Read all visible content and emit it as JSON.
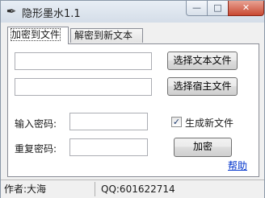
{
  "window": {
    "title": "隐形墨水1.1",
    "app_icon": "ink-brush-icon",
    "minimize_glyph": "—",
    "maximize_glyph": "□",
    "close_glyph": "✕"
  },
  "tabs": [
    {
      "label": "加密到文件",
      "active": true
    },
    {
      "label": "解密到新文本",
      "active": false
    }
  ],
  "encrypt_panel": {
    "text_file_path": "",
    "host_file_path": "",
    "select_text_button": "选择文本文件",
    "select_host_button": "选择宿主文件",
    "password_label": "输入密码:",
    "password_value": "",
    "repeat_label": "重复密码:",
    "repeat_value": "",
    "generate_new_file_label": "生成新文件",
    "generate_new_file_checked": true,
    "encrypt_button": "加密",
    "help_link": "帮助"
  },
  "statusbar": {
    "author": "作者:大海",
    "qq": "QQ:601622714"
  }
}
